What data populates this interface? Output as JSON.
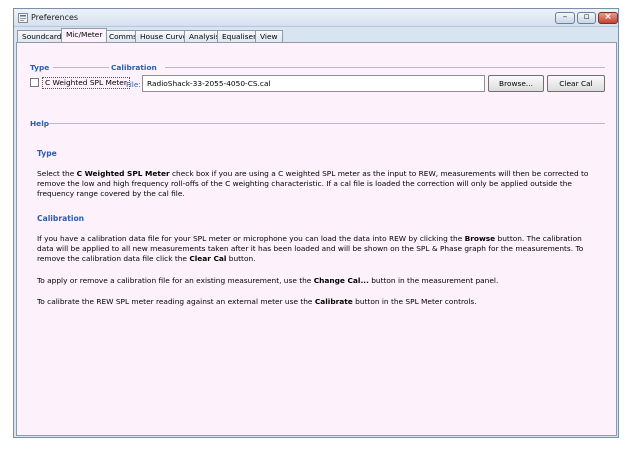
{
  "window": {
    "title": "Preferences"
  },
  "tabs": [
    "Soundcard",
    "Mic/Meter",
    "Comms",
    "House Curve",
    "Analysis",
    "Equaliser",
    "View"
  ],
  "sections": {
    "type": "Type",
    "calibration": "Calibration",
    "help": "Help"
  },
  "controls": {
    "c_weighted_label": "C Weighted SPL Meter",
    "c_weighted_checked": false,
    "file_label": "File:",
    "file_value": "RadioShack-33-2055-4050-CS.cal",
    "browse_label": "Browse...",
    "clear_cal_label": "Clear Cal"
  },
  "help": {
    "type_heading": "Type",
    "type_p1_a": "Select the ",
    "type_p1_b": "C Weighted SPL Meter",
    "type_p1_c": " check box if you are using a C weighted SPL meter as the input to REW, measurements will then be corrected to remove the low and high frequency roll-offs of the C weighting characteristic. If a cal file is loaded the correction will only be applied outside the frequency range covered by the cal file.",
    "calibration_heading": "Calibration",
    "cal_p1_a": "If you have a calibration data file for your SPL meter or microphone you can load the data into REW by clicking the ",
    "cal_p1_b": "Browse",
    "cal_p1_c": " button. The calibration data will be applied to all new measurements taken after it has been loaded and will be shown on the SPL & Phase graph for the measurements. To remove the calibration data file click the ",
    "cal_p1_d": "Clear Cal",
    "cal_p1_e": " button.",
    "cal_p2_a": "To apply or remove a calibration file for an existing measurement, use the ",
    "cal_p2_b": "Change Cal...",
    "cal_p2_c": " button in the measurement panel.",
    "cal_p3_a": "To calibrate the REW SPL meter reading against an external meter use the ",
    "cal_p3_b": "Calibrate",
    "cal_p3_c": " button in the SPL Meter controls."
  }
}
